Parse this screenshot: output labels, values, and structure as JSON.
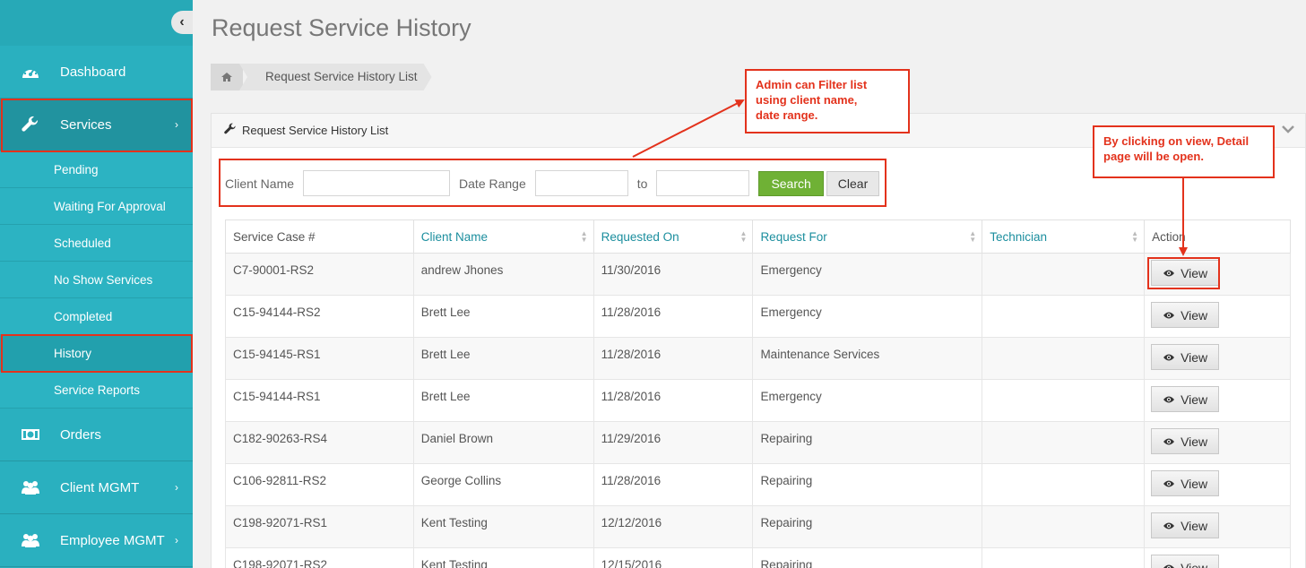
{
  "sidebar": {
    "collapse_glyph": "‹",
    "nav": [
      {
        "label": "Dashboard",
        "icon": "dashboard-icon"
      },
      {
        "label": "Services",
        "icon": "wrench-icon",
        "arrow": "›"
      }
    ],
    "sub_items": [
      "Pending",
      "Waiting For Approval",
      "Scheduled",
      "No Show Services",
      "Completed",
      "History",
      "Service Reports"
    ],
    "nav_bottom": [
      {
        "label": "Orders",
        "icon": "money-icon"
      },
      {
        "label": "Client MGMT",
        "icon": "users-icon",
        "arrow": "›"
      },
      {
        "label": "Employee MGMT",
        "icon": "users-icon",
        "arrow": "›"
      }
    ]
  },
  "page": {
    "title": "Request Service History",
    "breadcrumb": "Request Service History List"
  },
  "panel": {
    "title": "Request Service History List"
  },
  "filter": {
    "client_label": "Client Name",
    "date_label": "Date Range",
    "to_label": "to",
    "search_label": "Search",
    "clear_label": "Clear"
  },
  "table": {
    "headers": [
      "Service Case #",
      "Client Name",
      "Requested On",
      "Request For",
      "Technician",
      "Action"
    ],
    "view_label": "View",
    "rows": [
      [
        "C7-90001-RS2",
        "andrew Jhones",
        "11/30/2016",
        "Emergency",
        ""
      ],
      [
        "C15-94144-RS2",
        "Brett Lee",
        "11/28/2016",
        "Emergency",
        ""
      ],
      [
        "C15-94145-RS1",
        "Brett Lee",
        "11/28/2016",
        "Maintenance Services",
        ""
      ],
      [
        "C15-94144-RS1",
        "Brett Lee",
        "11/28/2016",
        "Emergency",
        ""
      ],
      [
        "C182-90263-RS4",
        "Daniel Brown",
        "11/29/2016",
        "Repairing",
        ""
      ],
      [
        "C106-92811-RS2",
        "George Collins",
        "11/28/2016",
        "Repairing",
        ""
      ],
      [
        "C198-92071-RS1",
        "Kent Testing",
        "12/12/2016",
        "Repairing",
        ""
      ],
      [
        "C198-92071-RS2",
        "Kent Testing",
        "12/15/2016",
        "Repairing",
        ""
      ]
    ]
  },
  "annotations": {
    "filter_note": [
      "Admin can Filter list",
      "using client name,",
      "date range."
    ],
    "view_note": [
      "By clicking on view, Detail",
      "page will be open."
    ]
  },
  "colors": {
    "sidebar": "#2aaebd",
    "accent": "#1b8e9e",
    "search_button": "#6fb135",
    "annotation": "#e3321c"
  }
}
